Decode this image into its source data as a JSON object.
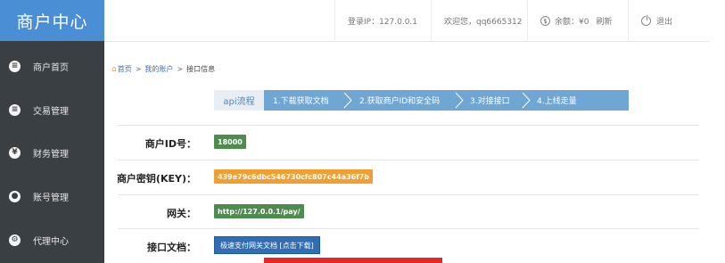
{
  "sidebar": {
    "title": "商户中心",
    "items": [
      {
        "icon": "list-icon",
        "glyph": "≡",
        "label": "商户首页"
      },
      {
        "icon": "list-icon",
        "glyph": "≡",
        "label": "交易管理"
      },
      {
        "icon": "yen-icon",
        "glyph": "¥",
        "label": "财务管理"
      },
      {
        "icon": "user-icon",
        "glyph": "●",
        "label": "账号管理"
      },
      {
        "icon": "agent-icon",
        "glyph": "⚙",
        "label": "代理中心"
      }
    ]
  },
  "header": {
    "login_ip": "登录IP：127.0.0.1",
    "welcome": "欢迎您，qq6665312",
    "balance": "余额：¥0",
    "refresh": "刷新",
    "logout": "退出"
  },
  "breadcrumb": {
    "home": "首页",
    "account": "我的账户",
    "current": "接口信息",
    "sep": ">"
  },
  "steps": {
    "first": "api流程",
    "items": [
      "1.下载获取文档",
      "2.获取商户ID和安全码",
      "3.对接接口",
      "4.上线走量"
    ]
  },
  "fields": {
    "merchant_id_label": "商户ID号：",
    "merchant_id_value": "18000",
    "key_label": "商户密钥(KEY)：",
    "key_value": "439e79c6dbc546730cfc807c44a36f7b",
    "gateway_label": "网关：",
    "gateway_value": "http://127.0.0.1/pay/",
    "doc_label": "接口文档：",
    "doc_button": "极速支付网关文档 [点击下载]"
  },
  "colors": {
    "sidebar_bg": "#3a3f44",
    "brand_bg": "#4a8fd6",
    "id_badge": "#4f8a4f",
    "key_badge": "#f0a032",
    "gateway_badge": "#4f8a4f",
    "step_bar": "#6fa6d3",
    "red_bar": "#e8262a"
  }
}
